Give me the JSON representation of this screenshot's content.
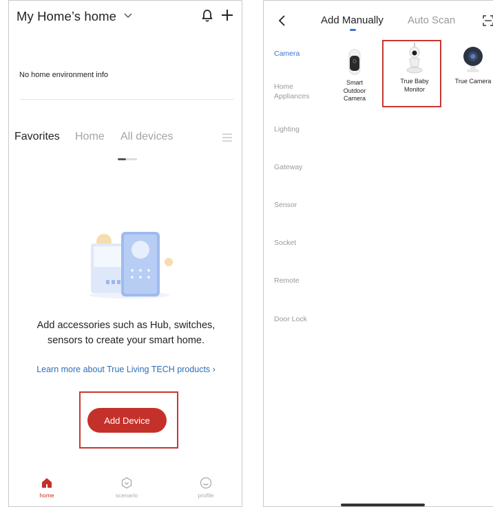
{
  "left_screen": {
    "header": {
      "home_title": "My Home’s home",
      "icons": [
        "chevron-down-icon",
        "bell-icon",
        "plus-icon"
      ]
    },
    "env_info": "No home environment info",
    "tabs": [
      {
        "label": "Favorites",
        "active": true
      },
      {
        "label": "Home",
        "active": false
      },
      {
        "label": "All devices",
        "active": false
      }
    ],
    "empty_state": {
      "message_line1": "Add accessories such as Hub, switches,",
      "message_line2": "sensors to create your smart home."
    },
    "learn_more": "Learn more about True Living TECH products ›",
    "add_device": "Add Device",
    "bottom_nav": [
      {
        "label": "home",
        "icon": "home-icon",
        "active": true
      },
      {
        "label": "scenario",
        "icon": "scenario-icon",
        "active": false
      },
      {
        "label": "profile",
        "icon": "profile-icon",
        "active": false
      }
    ]
  },
  "right_screen": {
    "header": {
      "tabs": [
        {
          "label": "Add Manually",
          "active": true
        },
        {
          "label": "Auto Scan",
          "active": false
        }
      ],
      "icons": [
        "back-icon",
        "scan-icon"
      ]
    },
    "categories": [
      {
        "label": "Camera",
        "active": true
      },
      {
        "label": "Home\nAppliances",
        "active": false
      },
      {
        "label": "Lighting",
        "active": false
      },
      {
        "label": "Gateway",
        "active": false
      },
      {
        "label": "Sensor",
        "active": false
      },
      {
        "label": "Socket",
        "active": false
      },
      {
        "label": "Remote",
        "active": false
      },
      {
        "label": "Door Lock",
        "active": false
      }
    ],
    "devices": [
      {
        "label": "Smart\nOutdoor\nCamera",
        "icon": "outdoor-camera-icon"
      },
      {
        "label": "True Baby\nMonitor",
        "icon": "baby-monitor-icon",
        "highlighted": true
      },
      {
        "label": "True Camera",
        "icon": "indoor-camera-icon"
      }
    ]
  },
  "colors": {
    "accent_red": "#c4312a",
    "highlight_red": "#c8362f",
    "link_blue": "#2f6fb6",
    "active_blue": "#3b73c7",
    "muted_gray": "#a4a4a4"
  }
}
